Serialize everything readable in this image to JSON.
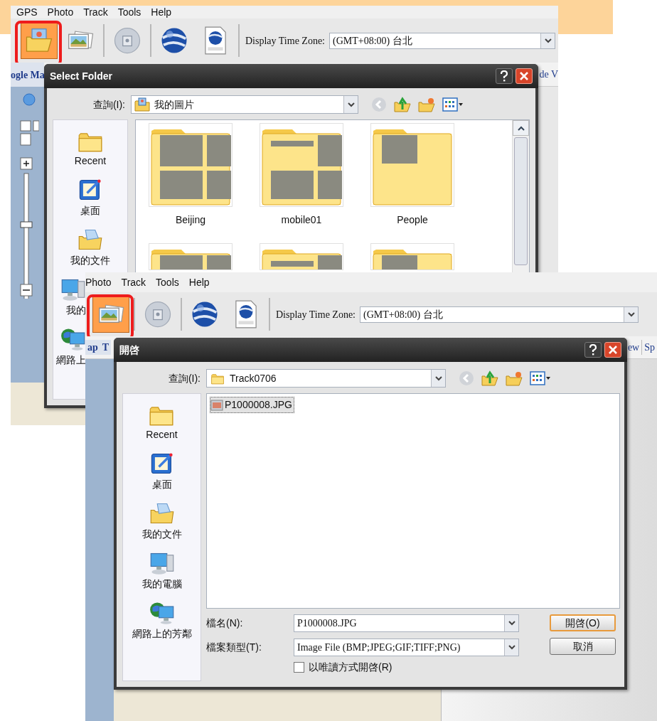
{
  "select_folder_window": {
    "menu": [
      {
        "label": "GPS"
      },
      {
        "label": "Photo"
      },
      {
        "label": "Track"
      },
      {
        "label": "Tools"
      },
      {
        "label": "Help"
      }
    ],
    "toolbar": [
      {
        "kind": "open-folder",
        "selected": true
      },
      {
        "kind": "photos",
        "selected": false
      },
      {
        "kind": "disc",
        "selected": false
      },
      {
        "kind": "globe",
        "selected": false
      },
      {
        "kind": "kmz",
        "selected": false
      }
    ],
    "time_zone": {
      "label": "Display Time Zone:",
      "value": "(GMT+08:00) 台北"
    },
    "left_tab": "ogle Ma",
    "right_tab": "de V",
    "dialog": {
      "title": "Select Folder",
      "look_in_label": "查詢(I):",
      "look_in_value": "我的圖片",
      "places": [
        {
          "kind": "recent",
          "label": "Recent"
        },
        {
          "kind": "desktop",
          "label": "桌面"
        },
        {
          "kind": "documents",
          "label": "我的文件"
        },
        {
          "kind": "computer",
          "label": "我的",
          "partial": true
        },
        {
          "kind": "network",
          "label": "網路上",
          "partial": true
        }
      ],
      "folders": [
        {
          "label": "Beijing"
        },
        {
          "label": "mobile01"
        },
        {
          "label": "People"
        }
      ]
    }
  },
  "open_window": {
    "menu": [
      {
        "label": "Photo"
      },
      {
        "label": "Track"
      },
      {
        "label": "Tools"
      },
      {
        "label": "Help"
      }
    ],
    "toolbar": [
      {
        "kind": "photos",
        "selected": true
      },
      {
        "kind": "disc",
        "selected": false
      },
      {
        "kind": "globe",
        "selected": false
      },
      {
        "kind": "kmz",
        "selected": false
      }
    ],
    "time_zone": {
      "label": "Display Time Zone:",
      "value": "(GMT+08:00) 台北"
    },
    "left_tabs": [
      "ap",
      "T"
    ],
    "right_tabs": [
      "ew",
      "Sp"
    ],
    "dialog": {
      "title": "開啓",
      "look_in_label": "查詢(I):",
      "look_in_value": "Track0706",
      "places": [
        {
          "kind": "recent",
          "label": "Recent"
        },
        {
          "kind": "desktop",
          "label": "桌面"
        },
        {
          "kind": "documents",
          "label": "我的文件"
        },
        {
          "kind": "computer",
          "label": "我的電腦"
        },
        {
          "kind": "network",
          "label": "網路上的芳鄰"
        }
      ],
      "files": [
        {
          "name": "P1000008.JPG",
          "selected": true
        }
      ],
      "file_name": {
        "label": "檔名(N):",
        "value": "P1000008.JPG"
      },
      "file_type": {
        "label": "檔案類型(T):",
        "value": "Image File (BMP;JPEG;GIF;TIFF;PNG)"
      },
      "read_only": {
        "label": "以唯讀方式開啓(R)",
        "checked": false
      },
      "buttons": [
        {
          "label": "開啓(O)",
          "default": true
        },
        {
          "label": "取消",
          "default": false
        }
      ]
    }
  }
}
